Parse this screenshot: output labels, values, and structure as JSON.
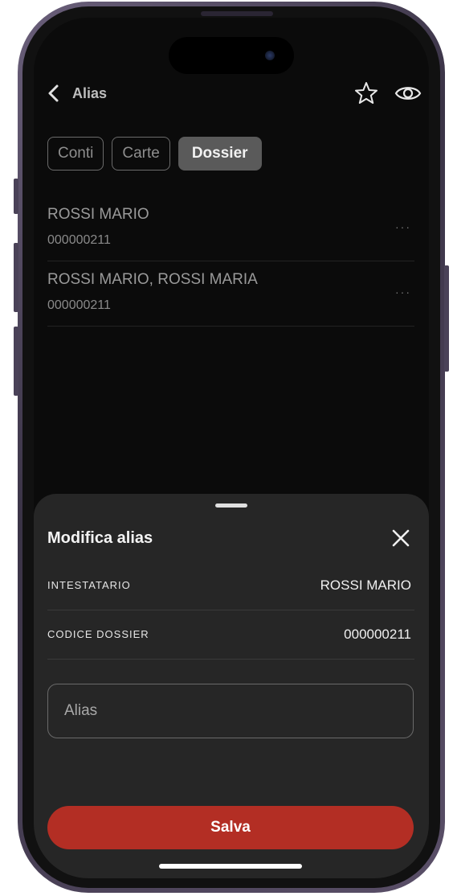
{
  "header": {
    "title": "Alias",
    "icons": [
      "back-chevron-icon",
      "star-icon",
      "eye-icon"
    ]
  },
  "tabs": [
    {
      "label": "Conti",
      "active": false
    },
    {
      "label": "Carte",
      "active": false
    },
    {
      "label": "Dossier",
      "active": true
    }
  ],
  "list": [
    {
      "title": "ROSSI MARIO",
      "code": "000000211",
      "more": "···"
    },
    {
      "title": "ROSSI MARIO, ROSSI MARIA",
      "code": "000000211",
      "more": "···"
    }
  ],
  "sheet": {
    "title": "Modifica alias",
    "rows": [
      {
        "label": "INTESTATARIO",
        "value": "ROSSI MARIO"
      },
      {
        "label": "CODICE DOSSIER",
        "value": "000000211"
      }
    ],
    "alias_placeholder": "Alias",
    "alias_value": "",
    "save_label": "Salva"
  },
  "colors": {
    "background": "#0b0b0b",
    "sheet": "#262626",
    "primary_button": "#b32e24",
    "active_tab": "#5a5a5a"
  }
}
